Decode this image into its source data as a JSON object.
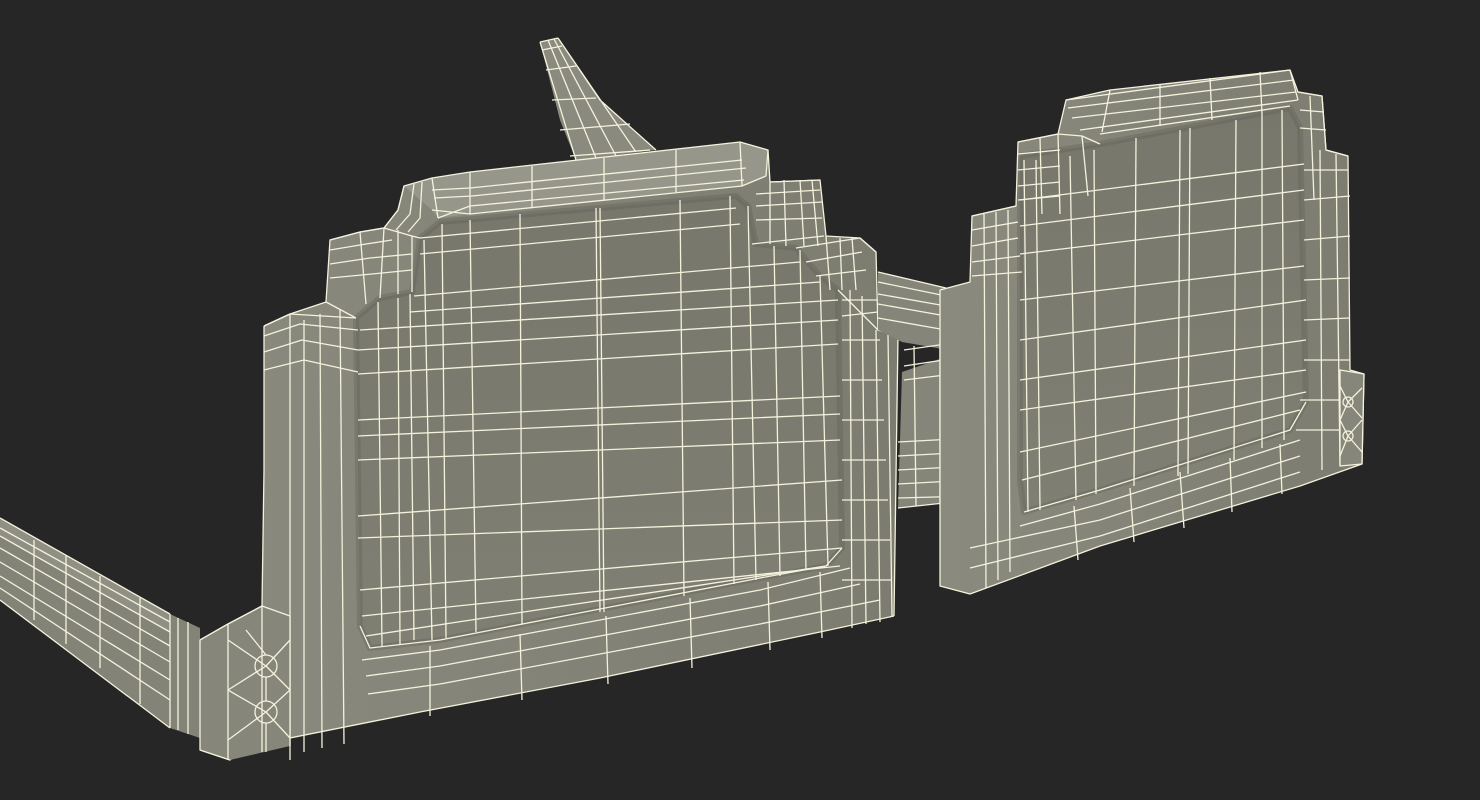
{
  "viewport": {
    "background_color": "#262626"
  },
  "model": {
    "subject": "rectangular-eyeglasses-frame",
    "display_mode": "wireframe-over-shaded",
    "surface_color": "#808074",
    "surface_shadow_color": "#6e6e63",
    "surface_light_color": "#94948a",
    "wire_color": "#f4f2dc"
  }
}
